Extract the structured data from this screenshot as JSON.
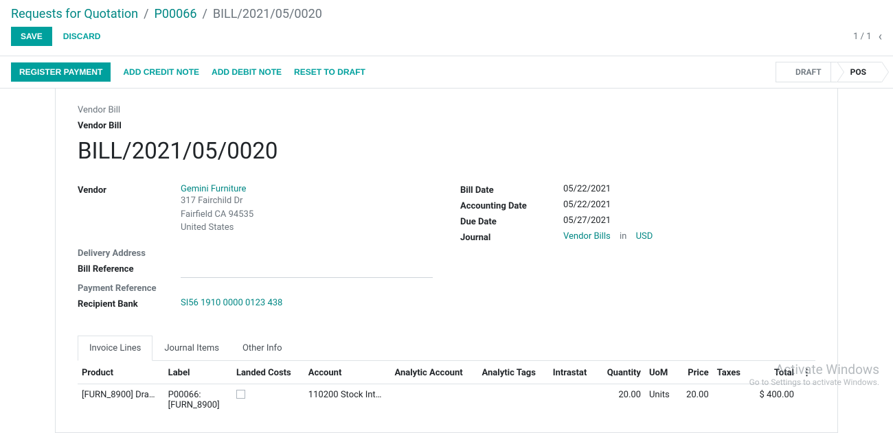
{
  "breadcrumb": {
    "root": "Requests for Quotation",
    "mid": "P00066",
    "current": "BILL/2021/05/0020"
  },
  "actions": {
    "save": "SAVE",
    "discard": "DISCARD",
    "pager": "1 / 1"
  },
  "toolbar": {
    "register_payment": "REGISTER PAYMENT",
    "add_credit_note": "ADD CREDIT NOTE",
    "add_debit_note": "ADD DEBIT NOTE",
    "reset_to_draft": "RESET TO DRAFT"
  },
  "status": {
    "draft": "DRAFT",
    "posted": "POS"
  },
  "doc": {
    "type": "Vendor Bill",
    "subtype": "Vendor Bill",
    "number": "BILL/2021/05/0020"
  },
  "left_fields": {
    "vendor_label": "Vendor",
    "vendor_name": "Gemini Furniture",
    "vendor_addr1": "317 Fairchild Dr",
    "vendor_addr2": "Fairfield CA 94535",
    "vendor_addr3": "United States",
    "delivery_address_label": "Delivery Address",
    "bill_reference_label": "Bill Reference",
    "payment_reference_label": "Payment Reference",
    "recipient_bank_label": "Recipient Bank",
    "recipient_bank_value": "SI56 1910 0000 0123 438"
  },
  "right_fields": {
    "bill_date_label": "Bill Date",
    "bill_date_value": "05/22/2021",
    "accounting_date_label": "Accounting Date",
    "accounting_date_value": "05/22/2021",
    "due_date_label": "Due Date",
    "due_date_value": "05/27/2021",
    "journal_label": "Journal",
    "journal_value": "Vendor Bills",
    "journal_in": "in",
    "journal_currency": "USD"
  },
  "tabs": {
    "invoice_lines": "Invoice Lines",
    "journal_items": "Journal Items",
    "other_info": "Other Info"
  },
  "grid": {
    "headers": {
      "product": "Product",
      "label": "Label",
      "landed_costs": "Landed Costs",
      "account": "Account",
      "analytic_account": "Analytic Account",
      "analytic_tags": "Analytic Tags",
      "intrastat": "Intrastat",
      "quantity": "Quantity",
      "uom": "UoM",
      "price": "Price",
      "taxes": "Taxes",
      "total": "Total"
    },
    "row0": {
      "product": "[FURN_8900] Dra…",
      "label_line1": "P00066:",
      "label_line2": "[FURN_8900]",
      "account": "110200 Stock Int…",
      "quantity": "20.00",
      "uom": "Units",
      "price": "20.00",
      "total": "$ 400.00"
    }
  },
  "watermark": {
    "line1": "Activate Windows",
    "line2": "Go to Settings to activate Windows."
  }
}
